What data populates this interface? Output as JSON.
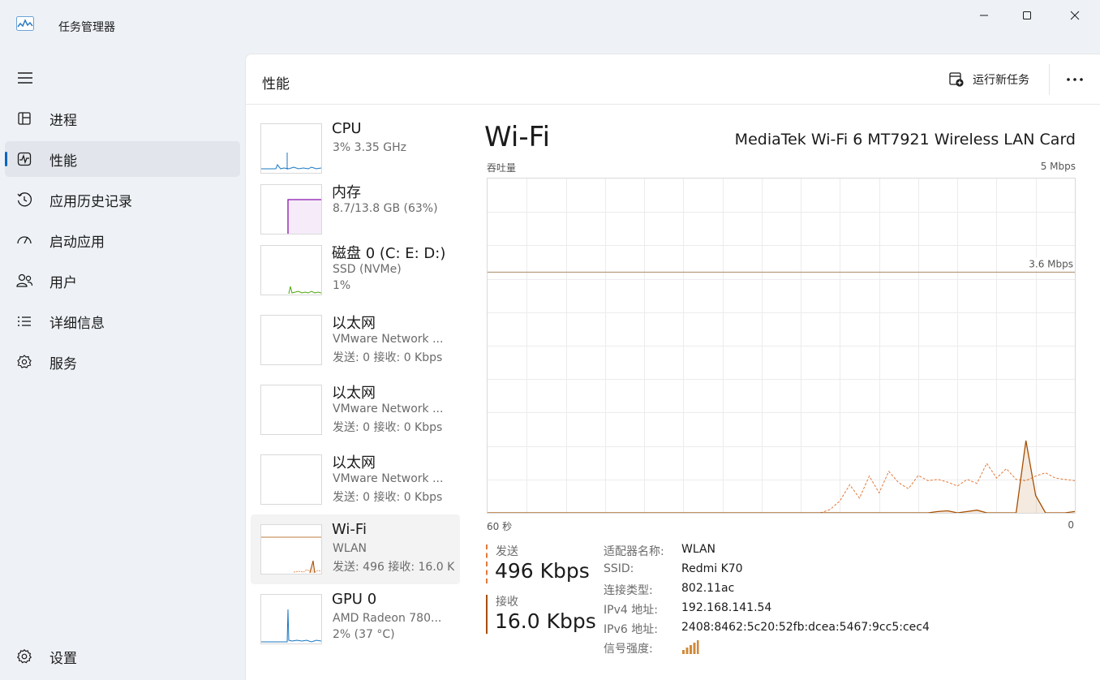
{
  "window": {
    "title": "任务管理器",
    "controls": [
      "minimize",
      "maximize",
      "close"
    ]
  },
  "sidebar": {
    "menu_icon": "hamburger-icon",
    "items": [
      {
        "label": "进程",
        "icon": "processes-icon"
      },
      {
        "label": "性能",
        "icon": "performance-icon",
        "active": true
      },
      {
        "label": "应用历史记录",
        "icon": "history-icon"
      },
      {
        "label": "启动应用",
        "icon": "startup-icon"
      },
      {
        "label": "用户",
        "icon": "users-icon"
      },
      {
        "label": "详细信息",
        "icon": "details-icon"
      },
      {
        "label": "服务",
        "icon": "services-icon"
      }
    ],
    "settings": {
      "label": "设置",
      "icon": "gear-icon"
    }
  },
  "header": {
    "title": "性能",
    "run_task_label": "运行新任务",
    "more_icon": "more-icon"
  },
  "devices": [
    {
      "name": "CPU",
      "sub1": "3% 3.35 GHz",
      "sub2": "",
      "color": "#1a78c2"
    },
    {
      "name": "内存",
      "sub1": "8.7/13.8 GB (63%)",
      "sub2": "",
      "color": "#8b12ae"
    },
    {
      "name": "磁盘 0 (C: E: D:)",
      "sub1": "SSD (NVMe)",
      "sub2": "1%",
      "color": "#4da60c"
    },
    {
      "name": "以太网",
      "sub1": "VMware Network ...",
      "sub2": "发送: 0 接收: 0 Kbps",
      "color": "#a74f01"
    },
    {
      "name": "以太网",
      "sub1": "VMware Network ...",
      "sub2": "发送: 0 接收: 0 Kbps",
      "color": "#a74f01"
    },
    {
      "name": "以太网",
      "sub1": "VMware Network ...",
      "sub2": "发送: 0 接收: 0 Kbps",
      "color": "#a74f01"
    },
    {
      "name": "Wi-Fi",
      "sub1": "WLAN",
      "sub2": "发送: 496 接收: 16.0 K",
      "color": "#a74f01",
      "selected": true
    },
    {
      "name": "GPU 0",
      "sub1": "AMD Radeon 780...",
      "sub2": "2% (37 °C)",
      "color": "#1a78c2"
    }
  ],
  "detail": {
    "title": "Wi-Fi",
    "adapter": "MediaTek Wi-Fi 6 MT7921 Wireless LAN Card",
    "chart_label": "吞吐量",
    "chart_max": "5 Mbps",
    "ref_line_label": "3.6 Mbps",
    "time_left": "60 秒",
    "time_right": "0",
    "send_label": "发送",
    "send_value": "496 Kbps",
    "recv_label": "接收",
    "recv_value": "16.0 Kbps",
    "accent_color": "#a74f01",
    "send_line_color": "#e2793b",
    "properties": [
      {
        "key": "适配器名称:",
        "value": "WLAN"
      },
      {
        "key": "SSID:",
        "value": "Redmi K70"
      },
      {
        "key": "连接类型:",
        "value": "802.11ac"
      },
      {
        "key": "IPv4 地址:",
        "value": "192.168.141.54"
      },
      {
        "key": "IPv6 地址:",
        "value": "2408:8462:5c20:52fb:dcea:5467:9cc5:cec4"
      },
      {
        "key": "信号强度:",
        "value": "",
        "icon": "signal-strength-icon"
      }
    ]
  },
  "chart_data": {
    "type": "line",
    "xlabel": "",
    "ylabel": "",
    "ylim": [
      0,
      5
    ],
    "x_range_seconds": [
      60,
      0
    ],
    "grid": true,
    "reference_line": 3.6,
    "series": [
      {
        "name": "发送",
        "style": "dashed",
        "values": [
          0,
          0,
          0,
          0,
          0,
          0,
          0,
          0,
          0,
          0,
          0,
          0,
          0,
          0,
          0,
          0,
          0,
          0,
          0,
          0,
          0,
          0,
          0,
          0,
          0,
          0,
          0,
          0,
          0,
          0,
          0,
          0,
          0,
          0,
          0,
          0.05,
          0.18,
          0.42,
          0.22,
          0.55,
          0.3,
          0.62,
          0.45,
          0.36,
          0.56,
          0.48,
          0.5,
          0.46,
          0.4,
          0.5,
          0.44,
          0.74,
          0.52,
          0.66,
          0.5,
          0.48,
          0.55,
          0.6,
          0.52,
          0.5,
          0.48
        ]
      },
      {
        "name": "接收",
        "style": "solid",
        "values": [
          0,
          0,
          0,
          0,
          0,
          0,
          0,
          0,
          0,
          0,
          0,
          0,
          0,
          0,
          0,
          0,
          0,
          0,
          0,
          0,
          0,
          0,
          0,
          0,
          0,
          0,
          0,
          0,
          0,
          0,
          0,
          0,
          0,
          0,
          0,
          0,
          0,
          0,
          0,
          0,
          0,
          0,
          0,
          0,
          0,
          0,
          0.02,
          0.03,
          0,
          0.02,
          0.04,
          0,
          0,
          0,
          0,
          1.08,
          0.26,
          0,
          0,
          0,
          0.02
        ]
      }
    ]
  }
}
